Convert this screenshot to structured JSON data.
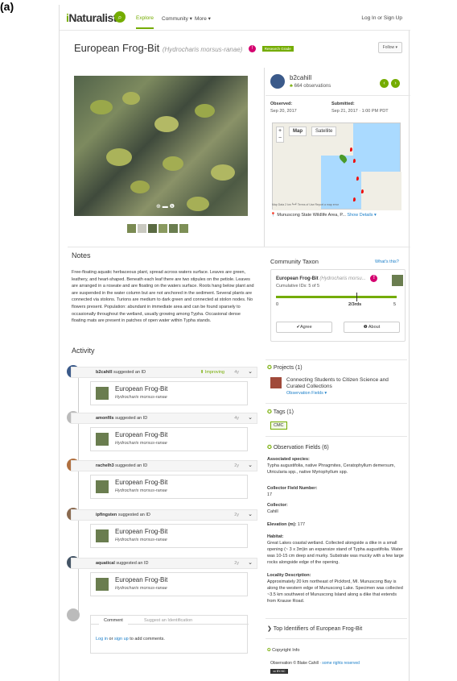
{
  "panel_label": "(a)",
  "nav": {
    "logo_i": "i",
    "logo_rest": "Naturalist",
    "search_icon": "⌕",
    "explore": "Explore",
    "community": "Community ▾",
    "more": "More ▾",
    "login": "Log In or Sign Up"
  },
  "header": {
    "common_name": "European Frog-Bit",
    "sci_name": "(Hydrocharis morsus-ranae)",
    "badge": "!",
    "grade": "Research Grade",
    "follow": "Follow ▾"
  },
  "photo": {
    "controls": "⊕ ▬ ❶"
  },
  "observer": {
    "username": "b2cahill",
    "observations": "664 observations",
    "observed_label": "Observed:",
    "observed_value": "Sep 20, 2017",
    "submitted_label": "Submitted:",
    "submitted_value": "Sep 21, 2017 · 1:00 PM PDT"
  },
  "map": {
    "tab_map": "Map",
    "tab_satellite": "Satellite",
    "zoom_in": "+",
    "zoom_out": "−",
    "footer": "Map Data   2 km ┗━┛   Terms of Use   Report a map error",
    "place": "Munuscong State Wildlife Area, P...",
    "show": "Show",
    "details": "Details ▾"
  },
  "notes": {
    "title": "Notes",
    "text": "Free-floating aquatic herbaceous plant, spread across waters surface. Leaves are green, leathery, and heart-shaped. Beneath each leaf there are two stipules on the petiole. Leaves are arranged in a roseate and are floating on the waters surface. Roots hang below plant and are suspended in the water column but are not anchored in the sediment. Several plants are connected via stolons. Turions are medium to dark green and connected at stolon nodes. No flowers present. Population: abundant in immediate area and can be found sparsely to occasionally throughout the wetland, usually growing among Typha. Occasional dense floating mats are present in patches of open water within Typha stands."
  },
  "community_taxon": {
    "title": "Community Taxon",
    "whats_this": "What's this?",
    "name": "European Frog-Bit",
    "sci": "(Hydrocharis morsu...",
    "cumulative": "Cumulative IDs: 5 of 5",
    "progress_fraction": 1.0,
    "bar_min": "0",
    "bar_mid": "2/3rds",
    "bar_max": "5",
    "agree": "✔Agree",
    "about": "❶ About"
  },
  "activity": {
    "title": "Activity",
    "items": [
      {
        "user": "b2cahill",
        "action": "suggested an ID",
        "age": "4y",
        "improving": "⬆ Improving",
        "common": "European Frog-Bit",
        "sci": "Hydrocharis morsus-ranae"
      },
      {
        "user": "amonfils",
        "action": "suggested an ID",
        "age": "4y",
        "improving": "",
        "common": "European Frog-Bit",
        "sci": "Hydrocharis morsus-ranae"
      },
      {
        "user": "rachelh3",
        "action": "suggested an ID",
        "age": "2y",
        "improving": "",
        "common": "European Frog-Bit",
        "sci": "Hydrocharis morsus-ranae"
      },
      {
        "user": "ipfingsten",
        "action": "suggested an ID",
        "age": "2y",
        "improving": "",
        "common": "European Frog-Bit",
        "sci": "Hydrocharis morsus-ranae"
      },
      {
        "user": "aquatical",
        "action": "suggested an ID",
        "age": "2y",
        "improving": "",
        "common": "European Frog-Bit",
        "sci": "Hydrocharis morsus-ranae"
      }
    ],
    "chevron": "⌄",
    "tab_comment": "Comment",
    "tab_suggest": "Suggest an Identification",
    "login_prompt_a": "Log in",
    "login_prompt_b": " or ",
    "login_prompt_c": "sign up",
    "login_prompt_d": " to add comments."
  },
  "sidebar": {
    "projects_title": "Projects (1)",
    "project_name": "Connecting Students to Citizen Science and Curated Collections",
    "project_fields": "Observation Fields ▾",
    "tags_title": "Tags (1)",
    "tag": "CMC",
    "of_title": "Observation Fields (6)",
    "fields": [
      {
        "label": "Associated species:",
        "value": "Typha augustifolia, native Phragmites, Ceratophyllum demersum, Utricularia spp., native Myriophyllum spp."
      },
      {
        "label": "Collector Field Number:",
        "value": "17"
      },
      {
        "label": "Collector:",
        "value": "Cahill"
      },
      {
        "label": "Elevation (m):",
        "value": "177"
      },
      {
        "label": "Habitat:",
        "value": "Great Lakes coastal wetland. Collected alongside a dike in a small opening (~ 3 x 3m)in an expansize stand of Typha augustifolia. Water was 10-15 cm deep and murky. Substrate was mucky with a few large rocks alongside edge of the opening."
      },
      {
        "label": "Locality Description:",
        "value": "Approximately 20 km northeast of Pickford, MI. Munuscong Bay is along the western edge of Munuscong Lake. Specimen was collected ~3.5 km southwest of Munuscong Island along a dike that extends from Krause Road."
      }
    ],
    "top_identifiers": "Top Identifiers of European Frog-Bit",
    "copyright_title": "Copyright Info",
    "copyright_text": "Observation © Blake Cahill · ",
    "copyright_link": "some rights reserved",
    "cc": "cc BY-NC"
  },
  "colors": {
    "accent": "#74ac00",
    "link": "#1a7ec8",
    "badge": "#d4006f"
  }
}
